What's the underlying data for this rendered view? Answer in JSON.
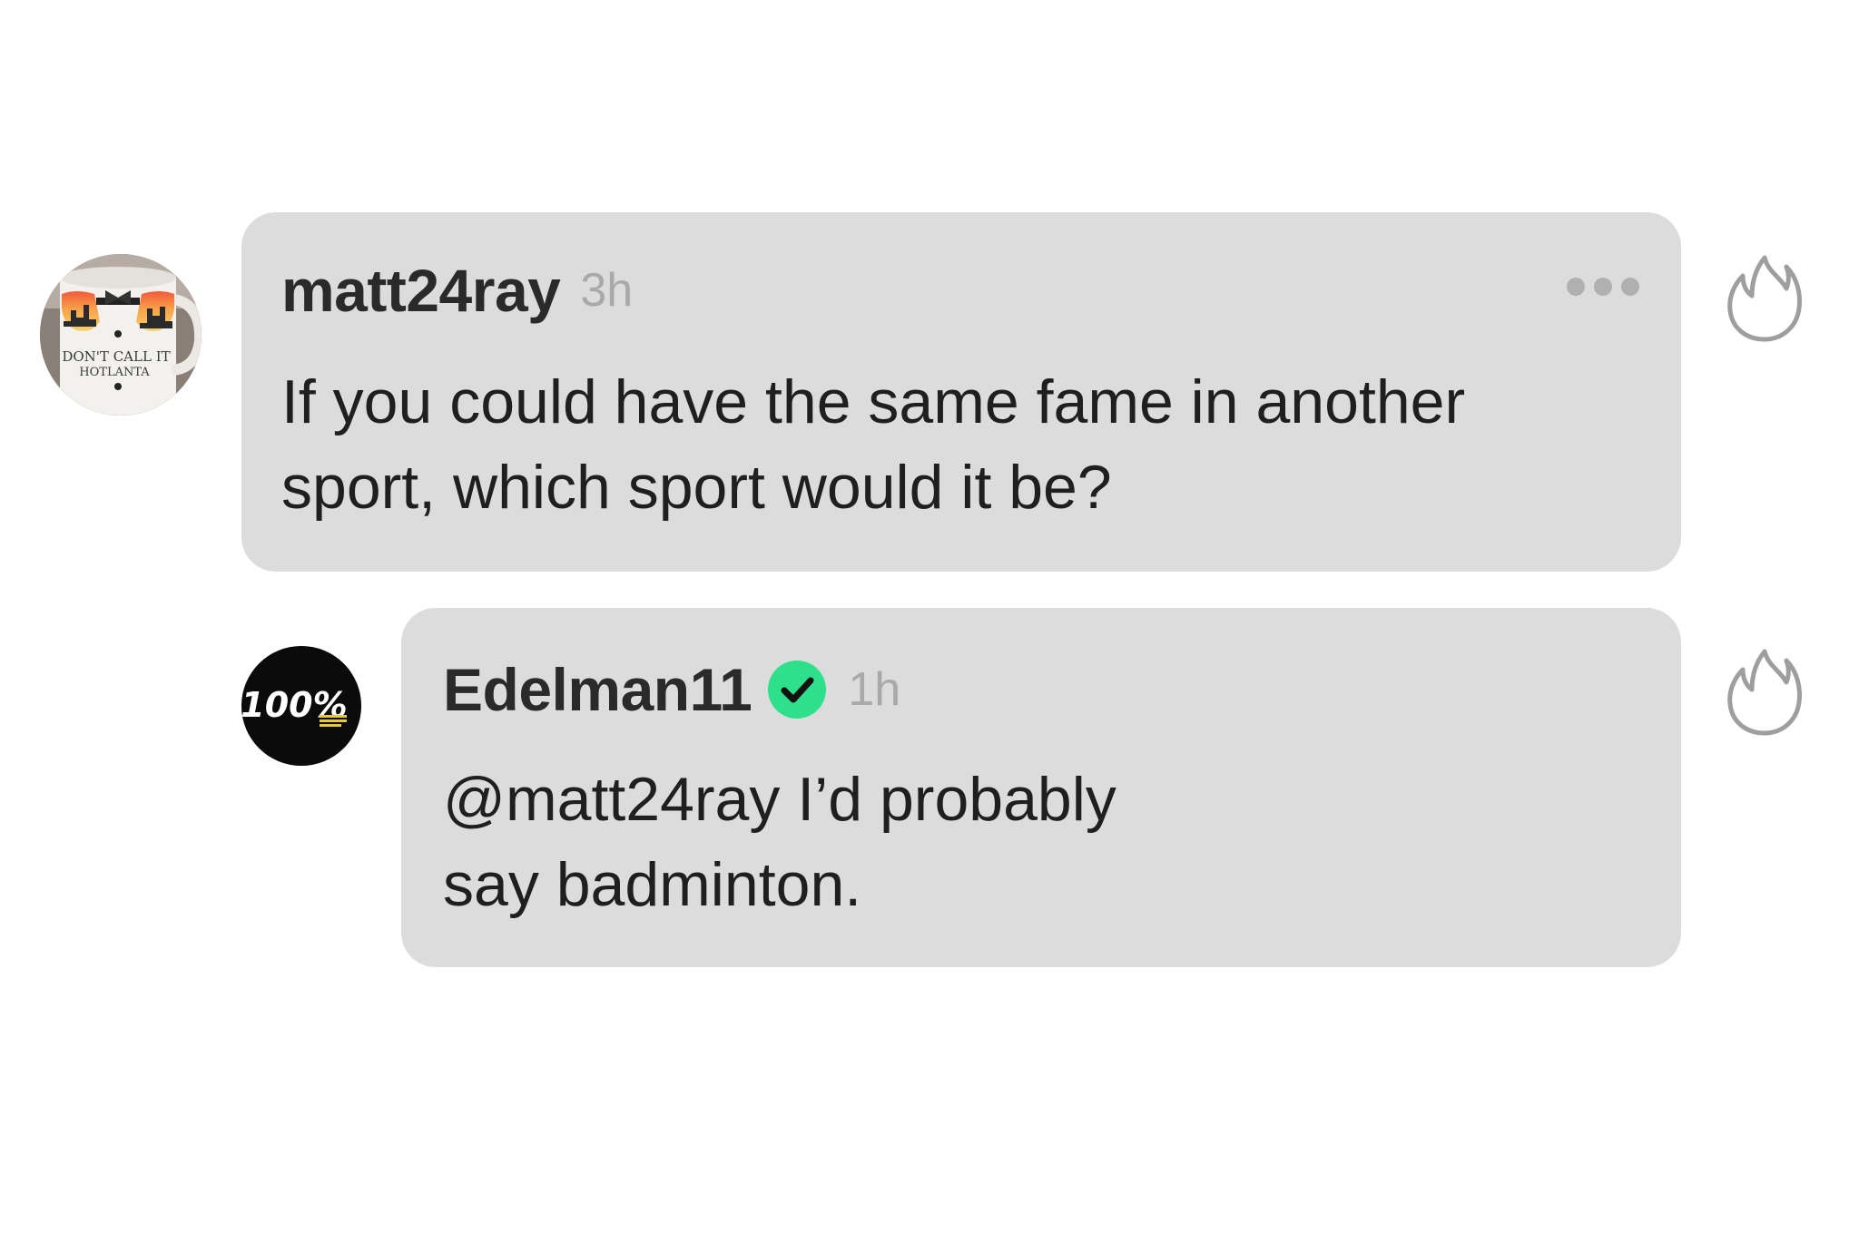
{
  "comments": [
    {
      "username": "matt24ray",
      "time": "3h",
      "text": "If you could have the same fame in another\nsport, which sport would it be?",
      "avatar": {
        "icon": "mug-avatar",
        "text_line1": "DON'T CALL IT",
        "text_line2": "HOTLANTA"
      },
      "more_icon": "more-dots-icon",
      "reaction_icon": "flame-icon"
    },
    {
      "username": "Edelman11",
      "time": "1h",
      "verified": true,
      "text": "@matt24ray I’d probably\nsay badminton.",
      "avatar": {
        "icon": "100-percent-logo",
        "logo_text": "100%"
      },
      "badge_icon": "verified-check-icon",
      "reaction_icon": "flame-icon"
    }
  ],
  "colors": {
    "bubble": "#dcdcdc",
    "username": "#2a2a2a",
    "timestamp": "#a9a9a9",
    "body": "#1f1f1f",
    "icon_gray": "#9e9e9e",
    "verified_green": "#2ee08a"
  }
}
